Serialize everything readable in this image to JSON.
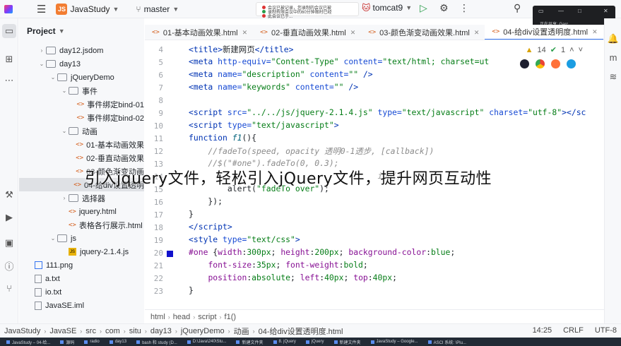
{
  "titlebar": {
    "project_badge": "JS",
    "project_name": "JavaStudy",
    "branch": "master",
    "notification_lines": [
      "会议已被记录，您录制的会议已被",
      "录制有限会议中的60分钟限时已经",
      "此会议已于..."
    ],
    "run_config": "tomcat9"
  },
  "project_panel": {
    "title": "Project",
    "items": [
      {
        "label": "day12.jsdom",
        "icon": "folder-icon",
        "depth": 1,
        "arrow": "›"
      },
      {
        "label": "day13",
        "icon": "folder-icon",
        "depth": 1,
        "arrow": "⌄"
      },
      {
        "label": "jQueryDemo",
        "icon": "folder-icon",
        "depth": 2,
        "arrow": "⌄"
      },
      {
        "label": "事件",
        "icon": "folder-icon",
        "depth": 3,
        "arrow": "⌄"
      },
      {
        "label": "事件绑定bind-01",
        "icon": "html-icon",
        "depth": 4,
        "arrow": ""
      },
      {
        "label": "事件绑定bind-02",
        "icon": "html-icon",
        "depth": 4,
        "arrow": ""
      },
      {
        "label": "动画",
        "icon": "folder-icon",
        "depth": 3,
        "arrow": "⌄"
      },
      {
        "label": "01-基本动画效果",
        "icon": "html-icon",
        "depth": 4,
        "arrow": ""
      },
      {
        "label": "02-垂直动画效果",
        "icon": "html-icon",
        "depth": 4,
        "arrow": ""
      },
      {
        "label": "03-颜色渐变动画",
        "icon": "html-icon",
        "depth": 4,
        "arrow": ""
      },
      {
        "label": "04-给div设置透明",
        "icon": "html-icon",
        "depth": 4,
        "arrow": ""
      },
      {
        "label": "选择器",
        "icon": "folder-icon",
        "depth": 3,
        "arrow": "›"
      },
      {
        "label": "jquery.html",
        "icon": "html-icon",
        "depth": 3,
        "arrow": ""
      },
      {
        "label": "表格各行展示.html",
        "icon": "html-icon",
        "depth": 3,
        "arrow": ""
      },
      {
        "label": "js",
        "icon": "folder-icon",
        "depth": 2,
        "arrow": "⌄"
      },
      {
        "label": "jquery-2.1.4.js",
        "icon": "js-icon",
        "depth": 3,
        "arrow": ""
      },
      {
        "label": "111.png",
        "icon": "image-icon",
        "depth": 0,
        "arrow": ""
      },
      {
        "label": "a.txt",
        "icon": "text-icon",
        "depth": 0,
        "arrow": ""
      },
      {
        "label": "io.txt",
        "icon": "text-icon",
        "depth": 0,
        "arrow": ""
      },
      {
        "label": "JavaSE.iml",
        "icon": "iml-icon",
        "depth": 0,
        "arrow": ""
      }
    ],
    "selected_index": 10
  },
  "tabs": [
    {
      "label": "01-基本动画效果.html",
      "active": false
    },
    {
      "label": "02-垂直动画效果.html",
      "active": false
    },
    {
      "label": "03-颜色渐变动画效果.html",
      "active": false
    },
    {
      "label": "04-给div设置透明度.html",
      "active": true
    }
  ],
  "editor": {
    "inspections": {
      "warnings": "14",
      "ok": "1"
    },
    "line_numbers": [
      "4",
      "5",
      "6",
      "7",
      "8",
      "9",
      "10",
      "11",
      "12",
      "13",
      "14",
      "15",
      "16",
      "17",
      "18",
      "19",
      "20",
      "21",
      "22",
      "23"
    ],
    "marked_line": "20"
  },
  "breadcrumbs": [
    "html",
    "head",
    "script",
    "f1()"
  ],
  "statusbar": {
    "path": [
      "JavaStudy",
      "JavaSE",
      "src",
      "com",
      "situ",
      "day13",
      "jQueryDemo",
      "动画",
      "04-给div设置透明度.html"
    ],
    "position": "14:25",
    "line_sep": "CRLF",
    "encoding": "UTF-8"
  },
  "popup": {
    "text": "正在共享: Garc"
  },
  "caption": "引入jquery文件，轻松引入jQuery文件，提升网页互动性",
  "taskbar": {
    "items": [
      "JavaStudy – 04-给...",
      "源码",
      "radio",
      "day13",
      "bash 和 study (D...",
      "D:\\Java\\240\\Stu...",
      "新建文件夹",
      "8. jQuery",
      "jQuery",
      "新建文件夹",
      "JavaStudy – Google...",
      "ASCI 系统: \\Plu..."
    ]
  },
  "colors": {
    "accent": "#3574f0",
    "project_badge": "#f27d32",
    "line_marker": "#1111cc"
  }
}
